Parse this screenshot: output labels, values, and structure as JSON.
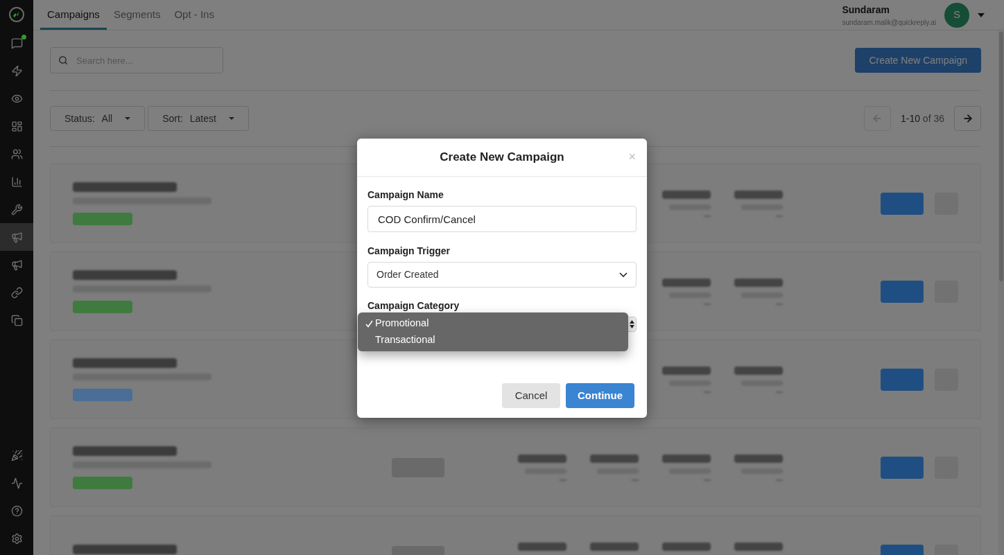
{
  "sidebar": {
    "items": [
      {
        "selected": false,
        "badge": true
      },
      {
        "selected": false
      },
      {
        "selected": false
      },
      {
        "selected": false
      },
      {
        "selected": false
      },
      {
        "selected": false
      },
      {
        "selected": false
      },
      {
        "selected": true
      },
      {
        "selected": false
      },
      {
        "selected": false
      },
      {
        "selected": false
      }
    ],
    "bottom_items": [
      {
        "selected": false
      },
      {
        "selected": false
      },
      {
        "selected": false
      },
      {
        "selected": false
      }
    ]
  },
  "tabs": [
    {
      "label": "Campaigns",
      "selected": true
    },
    {
      "label": "Segments",
      "selected": false
    },
    {
      "label": "Opt - Ins",
      "selected": false
    }
  ],
  "user": {
    "name": "Sundaram",
    "email": "sundaram.malik@quickreply.ai",
    "initial": "S"
  },
  "search": {
    "placeholder": "Search here..."
  },
  "create_button": "Create New Campaign",
  "filters": [
    {
      "label": "Status:",
      "value": "All"
    },
    {
      "label": "Sort:",
      "value": "Latest"
    }
  ],
  "pagination": {
    "range": "1-10",
    "total": "of 36",
    "prev_disabled": true,
    "next_disabled": false
  },
  "campaign_cards": [
    {
      "color": "#3f7a3f"
    },
    {
      "color": "#3f7a3f"
    },
    {
      "color": "#4a6e96"
    },
    {
      "color": "#3f7a3f",
      "draft": true
    },
    {
      "draft": true
    }
  ],
  "modal": {
    "title": "Create New Campaign",
    "close": "×",
    "fields": [
      {
        "kind": "text",
        "label": "Campaign Name",
        "value": "COD Confirm/Cancel"
      },
      {
        "kind": "select",
        "label": "Campaign Trigger",
        "value": "Order Created"
      },
      {
        "kind": "menu",
        "label": "Campaign Category",
        "options": [
          {
            "label": "Promotional",
            "selected": true
          },
          {
            "label": "Transactional",
            "selected": false
          }
        ]
      }
    ],
    "buttons": [
      {
        "label": "Cancel",
        "kind": "secondary"
      },
      {
        "label": "Continue",
        "kind": "primary"
      }
    ]
  }
}
